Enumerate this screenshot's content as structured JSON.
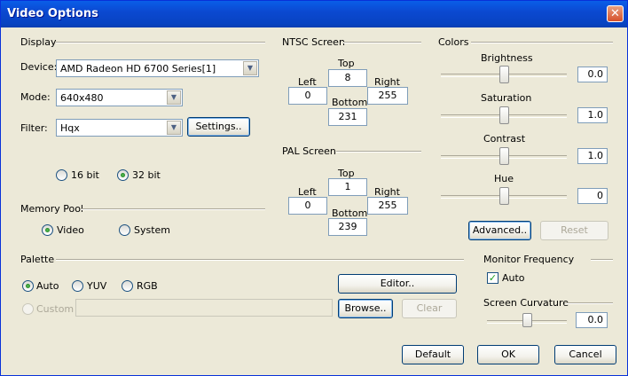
{
  "window": {
    "title": "Video Options",
    "close_glyph": "✕"
  },
  "display": {
    "group": "Display",
    "device_label": "Device:",
    "device_value": "AMD Radeon HD 6700 Series[1]",
    "mode_label": "Mode:",
    "mode_value": "640x480",
    "filter_label": "Filter:",
    "filter_value": "Hqx",
    "settings_button": "Settings..",
    "bit16": "16 bit",
    "bit32": "32 bit",
    "selected_bits": "32 bit"
  },
  "memory_pool": {
    "group": "Memory Pool",
    "video": "Video",
    "system": "System",
    "selected": "Video"
  },
  "ntsc": {
    "group": "NTSC Screen",
    "top_label": "Top",
    "top": "8",
    "left_label": "Left",
    "left": "0",
    "right_label": "Right",
    "right": "255",
    "bottom_label": "Bottom",
    "bottom": "231"
  },
  "pal": {
    "group": "PAL Screen",
    "top_label": "Top",
    "top": "1",
    "left_label": "Left",
    "left": "0",
    "right_label": "Right",
    "right": "255",
    "bottom_label": "Bottom",
    "bottom": "239"
  },
  "colors": {
    "group": "Colors",
    "brightness_label": "Brightness",
    "brightness": "0.0",
    "saturation_label": "Saturation",
    "saturation": "1.0",
    "contrast_label": "Contrast",
    "contrast": "1.0",
    "hue_label": "Hue",
    "hue": "0",
    "advanced_button": "Advanced..",
    "reset_button": "Reset"
  },
  "palette": {
    "group": "Palette",
    "auto": "Auto",
    "yuv": "YUV",
    "rgb": "RGB",
    "custom": "Custom",
    "selected": "Auto",
    "editor_button": "Editor..",
    "browse_button": "Browse..",
    "clear_button": "Clear",
    "custom_path": ""
  },
  "monitor": {
    "group": "Monitor Frequency",
    "auto_label": "Auto",
    "auto_checked": true
  },
  "curvature": {
    "group": "Screen Curvature",
    "value": "0.0"
  },
  "footer": {
    "default_button": "Default",
    "ok_button": "OK",
    "cancel_button": "Cancel"
  }
}
